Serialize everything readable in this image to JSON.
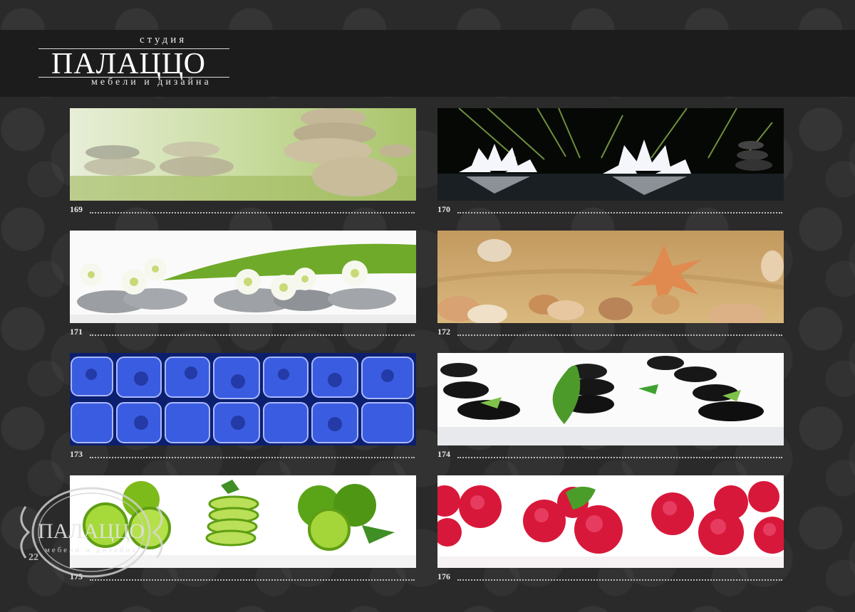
{
  "logo": {
    "top": "студия",
    "main": "ПАЛАЦЦО",
    "sub": "мебели и дизайна"
  },
  "items": [
    {
      "number": "169"
    },
    {
      "number": "170"
    },
    {
      "number": "171"
    },
    {
      "number": "172"
    },
    {
      "number": "173"
    },
    {
      "number": "174"
    },
    {
      "number": "175"
    },
    {
      "number": "176"
    }
  ],
  "watermark": {
    "main": "ПАЛАЦЦО",
    "sub": "мебели и дизайна"
  },
  "page_number": "22"
}
